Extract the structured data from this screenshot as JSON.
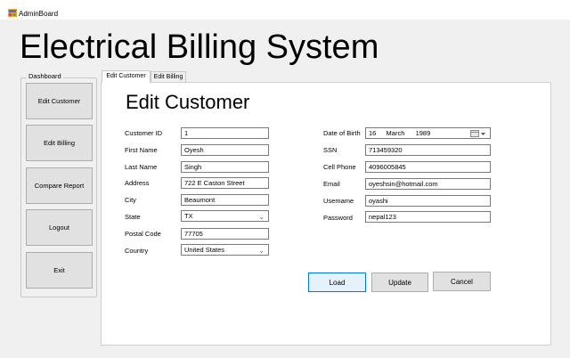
{
  "window": {
    "title": "AdminBoard"
  },
  "header": {
    "title": "Electrical Billing System"
  },
  "dashboard": {
    "label": "Dashboard",
    "buttons": [
      "Edit Customer",
      "Edit Billing",
      "Compare Report",
      "Logout",
      "Exit"
    ]
  },
  "tabs": [
    "Edit Customer",
    "Edit Billing"
  ],
  "form": {
    "title": "Edit Customer",
    "left": {
      "customer_id": {
        "label": "Customer ID",
        "value": "1"
      },
      "first_name": {
        "label": "First Name",
        "value": "Oyesh"
      },
      "last_name": {
        "label": "Last Name",
        "value": "Singh"
      },
      "address": {
        "label": "Address",
        "value": "722 E Caston Street"
      },
      "city": {
        "label": "City",
        "value": "Beaumont"
      },
      "state": {
        "label": "State",
        "value": "TX"
      },
      "postal_code": {
        "label": "Postal Code",
        "value": "77705"
      },
      "country": {
        "label": "Country",
        "value": "United States"
      }
    },
    "right": {
      "dob": {
        "label": "Date of Birth",
        "day": "16",
        "month": "March",
        "year": "1989"
      },
      "ssn": {
        "label": "SSN",
        "value": "713459320"
      },
      "cell": {
        "label": "Cell Phone",
        "value": "4096005845"
      },
      "email": {
        "label": "Email",
        "value": "oyeshsin@hotmail.com"
      },
      "username": {
        "label": "Usemame",
        "value": "oyashi"
      },
      "password": {
        "label": "Password",
        "value": "nepal123"
      }
    },
    "buttons": {
      "load": "Load",
      "update": "Update",
      "cancel": "Cancel"
    }
  },
  "colors": {
    "focus_border": "#0078d7",
    "button_face": "#e1e1e1"
  }
}
